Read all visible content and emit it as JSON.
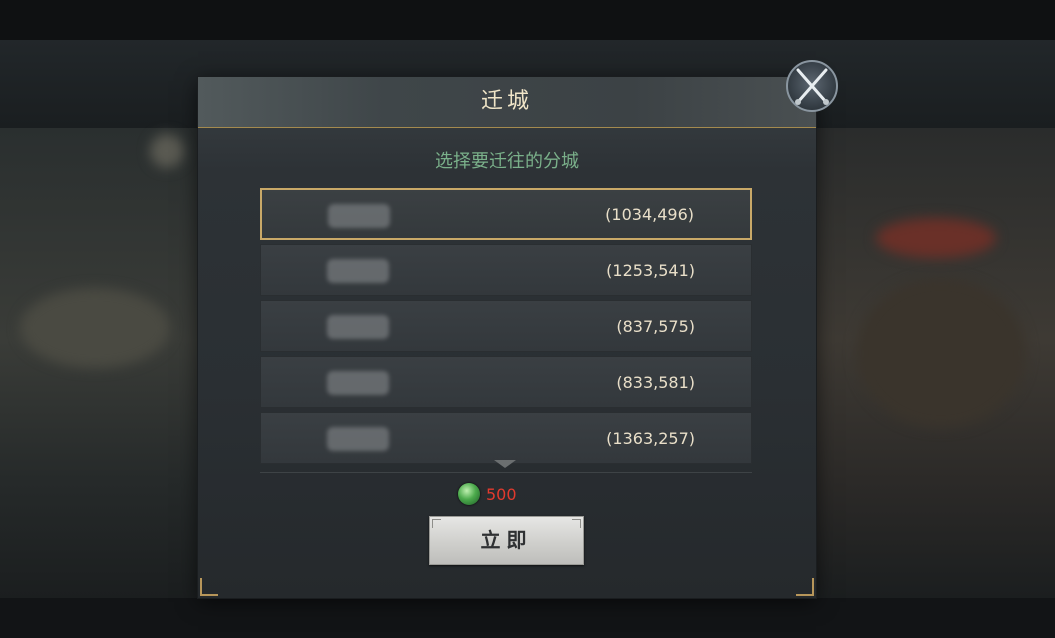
{
  "dialog": {
    "title": "迁城",
    "subtitle": "选择要迁往的分城",
    "branch_cities": [
      {
        "coords": "(1034,496)",
        "selected": true
      },
      {
        "coords": "(1253,541)",
        "selected": false
      },
      {
        "coords": "(837,575)",
        "selected": false
      },
      {
        "coords": "(833,581)",
        "selected": false
      },
      {
        "coords": "(1363,257)",
        "selected": false
      }
    ],
    "cost": {
      "icon": "jade-currency-icon",
      "value": "500"
    },
    "confirm_label": "立即",
    "close_icon": "crossed-swords-close-icon"
  },
  "colors": {
    "accent_gold": "#c9a968",
    "subtitle_green": "#7ab08a",
    "cost_red": "#e23a2e"
  }
}
